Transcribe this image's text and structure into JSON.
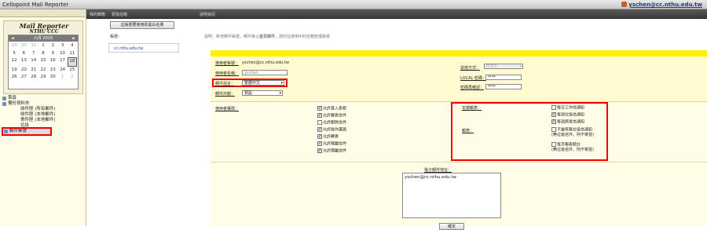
{
  "window": {
    "title": "Cellopoint Mail Reporter",
    "user": "yschen@cc.nthu.edu.tw"
  },
  "toolbar": {
    "items": [
      "我的郵箱",
      "更換信箱",
      "說明資訊"
    ]
  },
  "sidebar": {
    "logo_title": "Mail Reporter",
    "logo_sub": "NTHU CCC",
    "calendar": {
      "header": "六月 2016",
      "prev": "◄",
      "next": "►",
      "days": [
        "29",
        "30",
        "31",
        "1",
        "2",
        "3",
        "4",
        "5",
        "6",
        "7",
        "8",
        "9",
        "10",
        "11",
        "12",
        "13",
        "14",
        "15",
        "16",
        "17",
        "18",
        "19",
        "20",
        "21",
        "22",
        "23",
        "24",
        "25",
        "26",
        "27",
        "28",
        "29",
        "30",
        "1",
        "2"
      ],
      "today_index": 20
    },
    "tree": {
      "home": "首頁",
      "archive": "備份資料夾",
      "inbox_all": "收件匣 (所有郵件)",
      "inbox_local": "收件匣 (本地郵件)",
      "sent_local": "寄件匣 (本地郵件)",
      "trash": "垃圾",
      "settings": "郵件帳號"
    }
  },
  "main": {
    "top_button": "這帳號要使用的黑白名單",
    "crumb": "帳號：",
    "email_list": "cc.nthu.edu.tw",
    "hint_prefix": "說明：新增郵件帳號，郵件會以",
    "hint_bold": "首頁郵件",
    "hint_mid": "；請勿在使用中的",
    "hint_tail": "信箱管理帳號"
  },
  "form": {
    "account_label": "使用者帳號：",
    "account_value": "yschen@cc.nthu.edu.tw",
    "username_label": "使用者名稱：",
    "username_value": "yschen",
    "content_label": "郵件語言：",
    "content_value": "繁體中文",
    "page_label": "郵件外觀：",
    "page_value": "預設",
    "auth_label": "認證方式：",
    "auth_value": "POP3",
    "local_pw_label": "LOCAL 密碼：",
    "local_pw_value": "****",
    "confirm_pw_label": "密碼再確認：",
    "confirm_pw_value": "****",
    "perm_label": "使用者權限：",
    "perms": [
      "允許登入系統",
      "允許察看信件",
      "允許刪除信件",
      "允許操作畫面",
      "允許轉寄",
      "允許隔離信件",
      "允許隔離信件"
    ],
    "perms_checked": [
      true,
      true,
      false,
      true,
      true,
      true,
      true
    ],
    "schedule_label": "定期報表：",
    "notify_label": "報表：",
    "notify_opts": [
      "每日工作信通知",
      "每週垃圾信通知",
      "每週病毒信通知",
      "不論有無垃圾信通知\n(無垃圾信件，則不寄發)",
      "每月報表統計\n(無垃圾信件，則不寄發)"
    ],
    "notify_checked": [
      false,
      true,
      true,
      false,
      false
    ],
    "email_label": "電子郵件地址：",
    "email_value": "yschen@cc.nthu.edu.tw",
    "ok": "確定"
  }
}
